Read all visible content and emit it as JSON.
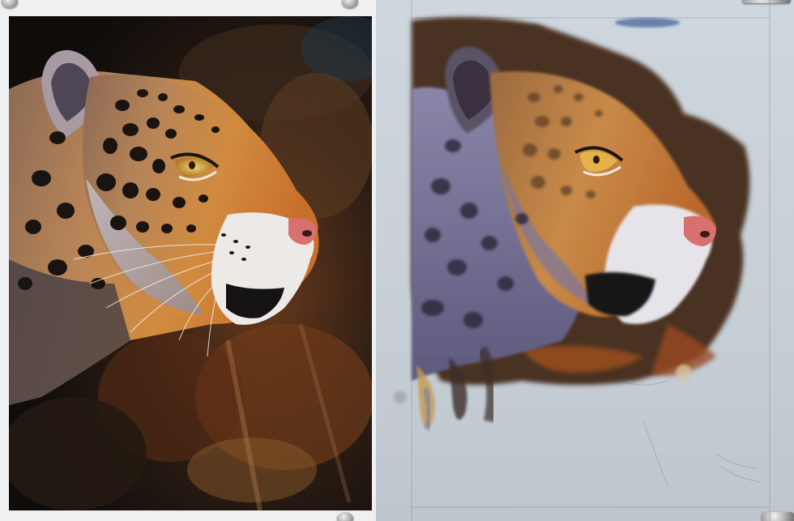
{
  "scene": {
    "left_panel": "reference-photograph",
    "right_panel": "pastel-painting-in-progress",
    "subject": "jaguar-head-profile",
    "colors": {
      "photo_background_dark": "#1f1a14",
      "fur_orange": "#c9772f",
      "fur_gold": "#e0a25a",
      "spot_black": "#1a1410",
      "muzzle_white": "#eceae6",
      "nose_pink": "#d8706d",
      "eye_amber": "#e3b24a",
      "paper_blue_grey": "#c9d1d9",
      "painting_violet": "#6e6a8e",
      "painting_brown": "#5a3b28",
      "painting_rust": "#9a4a22"
    }
  }
}
